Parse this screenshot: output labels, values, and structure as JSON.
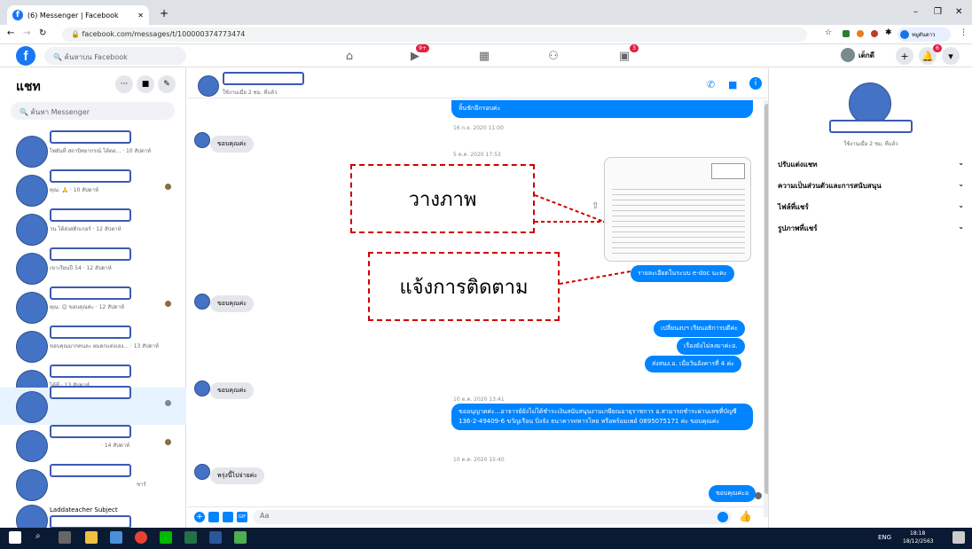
{
  "browser": {
    "tab_title": "(6) Messenger | Facebook",
    "url": "facebook.com/messages/t/100000374773474",
    "profile_label": "หมูตันดาว"
  },
  "fbnav": {
    "search_placeholder": "ค้นหาบน Facebook",
    "video_badge": "9+",
    "pages_badge": "3",
    "user_name": "เด็กดี",
    "notif_badge": "6"
  },
  "left": {
    "title": "แชท",
    "search_placeholder": "ค้นหา Messenger",
    "items": [
      {
        "sub": "ไพยันที่ สถาบิทยากรณ์ ได้ตอ... · 10 สัปดาห์"
      },
      {
        "sub": "คุณ: 🙏 · 10 สัปดาห์"
      },
      {
        "sub": "วน ได้ส่งสติกเกอร์ · 12 สัปดาห์"
      },
      {
        "sub": "เขาเรียนปี 54 · 12 สัปดาห์"
      },
      {
        "sub": "คุณ: 😊 ขอบคุณค่ะ · 12 สัปดาห์"
      },
      {
        "sub": "ขอบคุณมากคนละ ผมตกแต่งเอง... · 13 สัปดาห์"
      },
      {
        "sub": "ได้ที่ · 13 สัปดาห์"
      },
      {
        "sub": ""
      },
      {
        "sub": "· 14 สัปดาห์"
      },
      {
        "sub": "ชาร์"
      },
      {
        "sub": "Laddateacher Subject"
      }
    ]
  },
  "mid": {
    "status": "ใช้งานเมื่อ 2 ชม. ที่แล้ว",
    "top_bubble": "ลิ้นชักอีกรอบค่ะ",
    "ts1": "16 ก.ย. 2020 11:00",
    "thanks": "ขอบคุณค่ะ",
    "ts2": "5 ต.ค. 2020 17:53",
    "doc_bubble": "รายละเอียดในระบบ e-doc นะคะ",
    "callout_image": "วางภาพ",
    "callout_follow": "แจ้งการติดตาม",
    "thanks2": "ขอบคุณค่ะ",
    "out1": "เปลี่ยนงบฯ เรียนอธิการบดีค่ะ",
    "out2": "เรื่องยังไม่ลงมาค่ะอ.",
    "out3": "ส่งสนง.อ. เมื่อวันอังคารที่ 4 ค่ะ",
    "thanks3": "ขอบคุณค่ะ",
    "ts3": "10 ต.ค. 2020 13:41",
    "long_msg": "ขออนุญาตค่ะ...อาจารย์ยังไม่ได้ชำระเงินสนับสนุนงานเกษียณอายุราชการ อ.สามารถชำระผ่านเลขที่บัญชี 136-2-49409-6 ขวัญเรือน ปิ่งจัง ธนาคารทหารไทย หรือพร้อมเพย์ 0895075171 ค่ะ ขอบคุณค่ะ",
    "ts4": "10 ต.ค. 2020 15:40",
    "tomorrow": "พรุ่งนี้ไปจ่ายค่ะ",
    "last_out": "ขอบคุณค่ะอ",
    "composer_placeholder": "Aa"
  },
  "right": {
    "status": "ใช้งานเมื่อ 2 ชม. ที่แล้ว",
    "opt1": "ปรับแต่งแชท",
    "opt2": "ความเป็นส่วนตัวและการสนับสนุน",
    "opt3": "ไฟล์ที่แชร์",
    "opt4": "รูปภาพที่แชร์"
  },
  "taskbar": {
    "lang": "ENG",
    "time": "18:18",
    "date": "18/12/2563"
  }
}
